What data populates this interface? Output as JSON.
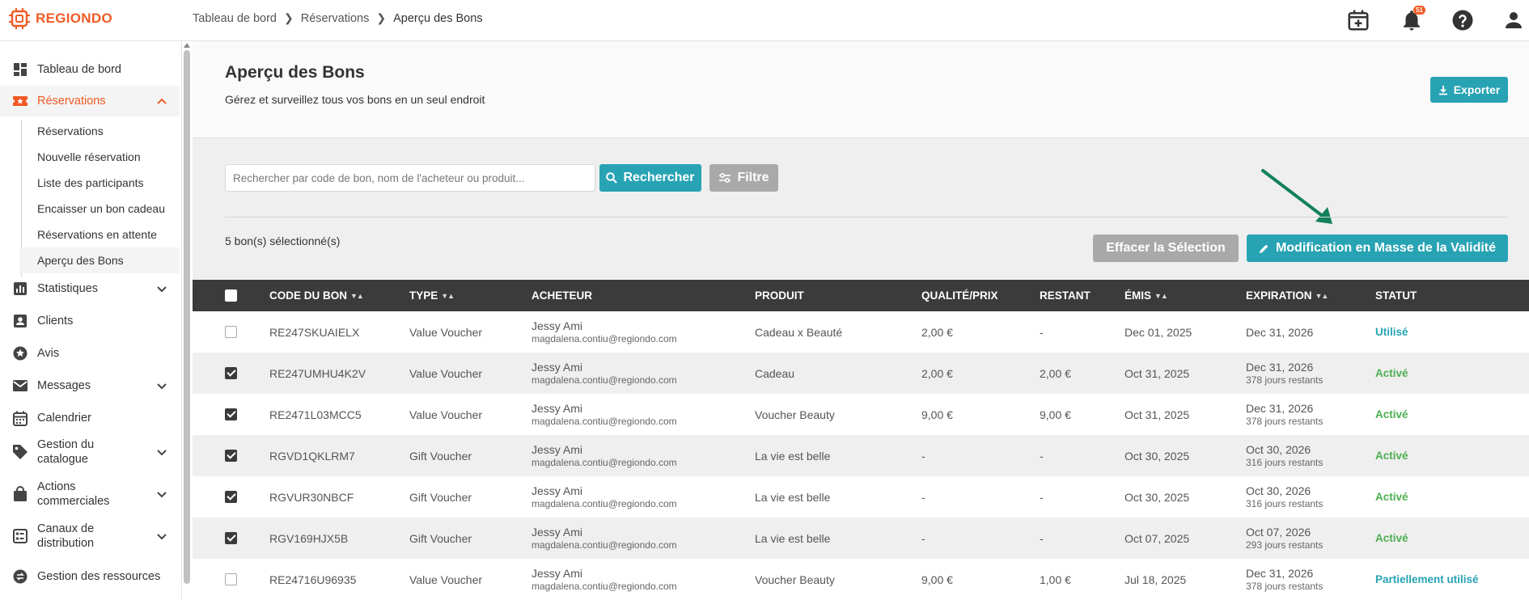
{
  "app": {
    "logo_text": "REGIONDO",
    "brand_color": "#f15a24",
    "accent_color": "#27a3b4"
  },
  "breadcrumb": [
    "Tableau de bord",
    "Réservations",
    "Aperçu des Bons"
  ],
  "topbar": {
    "notification_count": "51",
    "icons": [
      "calendar-plus-icon",
      "bell-icon",
      "help-icon",
      "user-icon"
    ]
  },
  "sidebar": {
    "items": [
      {
        "label": "Tableau de bord",
        "icon": "dashboard-icon"
      },
      {
        "label": "Réservations",
        "icon": "ticket-icon",
        "expanded": true
      },
      {
        "label": "Statistiques",
        "icon": "bar-chart-icon"
      },
      {
        "label": "Clients",
        "icon": "contact-icon"
      },
      {
        "label": "Avis",
        "icon": "star-icon"
      },
      {
        "label": "Messages",
        "icon": "mail-icon"
      },
      {
        "label": "Calendrier",
        "icon": "calendar-icon"
      },
      {
        "label": "Gestion du catalogue",
        "label_1": "Gestion du",
        "label_2": "catalogue",
        "icon": "tag-icon"
      },
      {
        "label": "Actions commerciales",
        "label_1": "Actions",
        "label_2": "commerciales",
        "icon": "shopping-bag-icon"
      },
      {
        "label": "Canaux de distribution",
        "label_1": "Canaux de",
        "label_2": "distribution",
        "icon": "channels-icon"
      },
      {
        "label": "Gestion des ressources",
        "icon": "swap-icon"
      }
    ],
    "sub_items": [
      "Réservations",
      "Nouvelle réservation",
      "Liste des participants",
      "Encaisser un bon cadeau",
      "Réservations en attente",
      "Aperçu des Bons"
    ]
  },
  "page": {
    "title": "Aperçu des Bons",
    "subtitle": "Gérez et surveillez tous vos bons en un seul endroit",
    "export_label": "Exporter",
    "search_placeholder": "Rechercher par code de bon, nom de l'acheteur ou produit...",
    "search_label": "Rechercher",
    "filter_label": "Filtre",
    "selection_count": "5 bon(s) sélectionné(s)",
    "clear_label": "Effacer la Sélection",
    "mass_edit_label": "Modification en Masse de la Validité"
  },
  "table": {
    "columns": [
      "CODE DU BON",
      "TYPE",
      "ACHETEUR",
      "PRODUIT",
      "QUALITÉ/PRIX",
      "RESTANT",
      "ÉMIS",
      "EXPIRATION",
      "STATUT"
    ],
    "rows": [
      {
        "checked": false,
        "code": "RE247SKUAIELX",
        "type": "Value Voucher",
        "buyer": "Jessy Ami",
        "email": "magdalena.contiu@regiondo.com",
        "product": "Cadeau x Beauté",
        "price": "2,00 €",
        "remaining": "-",
        "issued": "Dec 01, 2025",
        "expiration": "Dec 31, 2026",
        "days_left": "",
        "status": "Utilisé",
        "status_color": "#27a3b4"
      },
      {
        "checked": true,
        "code": "RE247UMHU4K2V",
        "type": "Value Voucher",
        "buyer": "Jessy Ami",
        "email": "magdalena.contiu@regiondo.com",
        "product": "Cadeau",
        "price": "2,00 €",
        "remaining": "2,00 €",
        "issued": "Oct 31, 2025",
        "expiration": "Dec 31, 2026",
        "days_left": "378 jours restants",
        "status": "Activé",
        "status_color": "#4caf50"
      },
      {
        "checked": true,
        "code": "RE2471L03MCC5",
        "type": "Value Voucher",
        "buyer": "Jessy Ami",
        "email": "magdalena.contiu@regiondo.com",
        "product": "Voucher Beauty",
        "price": "9,00 €",
        "remaining": "9,00 €",
        "issued": "Oct 31, 2025",
        "expiration": "Dec 31, 2026",
        "days_left": "378 jours restants",
        "status": "Activé",
        "status_color": "#4caf50"
      },
      {
        "checked": true,
        "code": "RGVD1QKLRM7",
        "type": "Gift Voucher",
        "buyer": "Jessy Ami",
        "email": "magdalena.contiu@regiondo.com",
        "product": "La vie est belle",
        "price": "-",
        "remaining": "-",
        "issued": "Oct 30, 2025",
        "expiration": "Oct 30, 2026",
        "days_left": "316 jours restants",
        "status": "Activé",
        "status_color": "#4caf50"
      },
      {
        "checked": true,
        "code": "RGVUR30NBCF",
        "type": "Gift Voucher",
        "buyer": "Jessy Ami",
        "email": "magdalena.contiu@regiondo.com",
        "product": "La vie est belle",
        "price": "-",
        "remaining": "-",
        "issued": "Oct 30, 2025",
        "expiration": "Oct 30, 2026",
        "days_left": "316 jours restants",
        "status": "Activé",
        "status_color": "#4caf50"
      },
      {
        "checked": true,
        "code": "RGV169HJX5B",
        "type": "Gift Voucher",
        "buyer": "Jessy Ami",
        "email": "magdalena.contiu@regiondo.com",
        "product": "La vie est belle",
        "price": "-",
        "remaining": "-",
        "issued": "Oct 07, 2025",
        "expiration": "Oct 07, 2026",
        "days_left": "293 jours restants",
        "status": "Activé",
        "status_color": "#4caf50"
      },
      {
        "checked": false,
        "code": "RE24716U96935",
        "type": "Value Voucher",
        "buyer": "Jessy Ami",
        "email": "magdalena.contiu@regiondo.com",
        "product": "Voucher Beauty",
        "price": "9,00 €",
        "remaining": "1,00 €",
        "issued": "Jul 18, 2025",
        "expiration": "Dec 31, 2026",
        "days_left": "378 jours restants",
        "status": "Partiellement utilisé",
        "status_color": "#27a3b4"
      }
    ]
  }
}
